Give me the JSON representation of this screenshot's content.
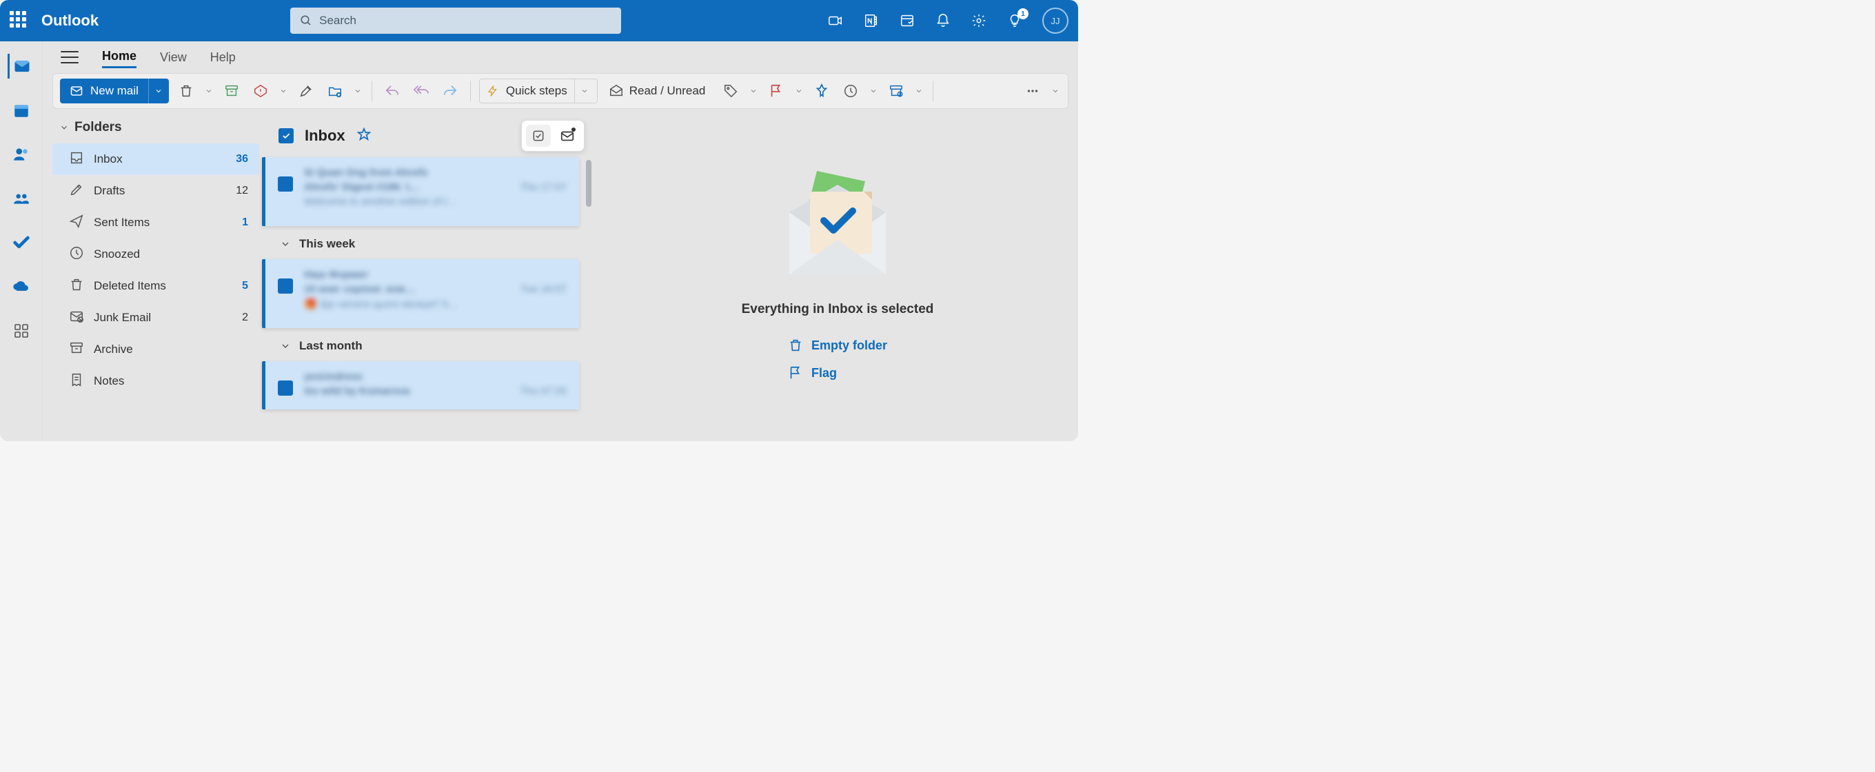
{
  "app_name": "Outlook",
  "search": {
    "placeholder": "Search"
  },
  "titlebar": {
    "tips_badge": "1",
    "avatar_initials": "JJ"
  },
  "tabs": {
    "home": "Home",
    "view": "View",
    "help": "Help"
  },
  "ribbon": {
    "new_mail": "New mail",
    "quick_steps": "Quick steps",
    "read_unread": "Read / Unread"
  },
  "folders_header": "Folders",
  "folders": [
    {
      "name": "Inbox",
      "count": "36",
      "bold": true,
      "icon": "inbox"
    },
    {
      "name": "Drafts",
      "count": "12",
      "bold": false,
      "icon": "drafts"
    },
    {
      "name": "Sent Items",
      "count": "1",
      "bold": true,
      "icon": "sent"
    },
    {
      "name": "Snoozed",
      "count": "",
      "bold": false,
      "icon": "clock"
    },
    {
      "name": "Deleted Items",
      "count": "5",
      "bold": true,
      "icon": "trash"
    },
    {
      "name": "Junk Email",
      "count": "2",
      "bold": false,
      "icon": "junk"
    },
    {
      "name": "Archive",
      "count": "",
      "bold": false,
      "icon": "archive"
    },
    {
      "name": "Notes",
      "count": "",
      "bold": false,
      "icon": "notes"
    }
  ],
  "msglist": {
    "title": "Inbox",
    "groups": {
      "this_week": "This week",
      "last_month": "Last month"
    }
  },
  "reading": {
    "status": "Everything in Inbox is selected",
    "empty_folder": "Empty folder",
    "flag": "Flag"
  }
}
